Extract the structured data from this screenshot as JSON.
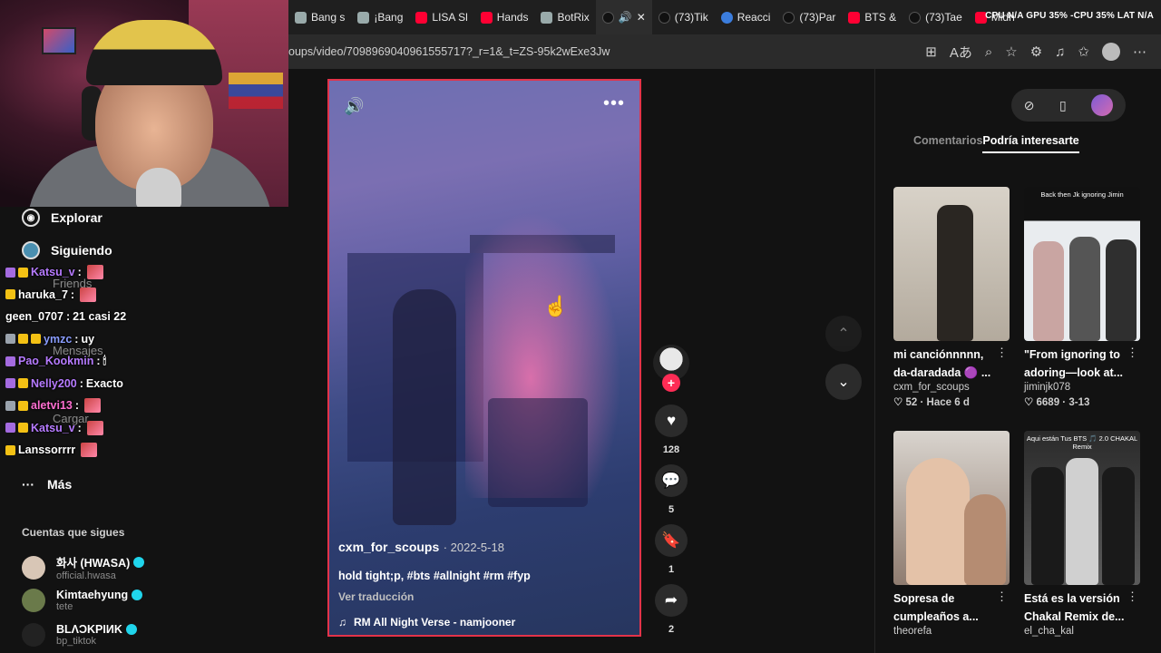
{
  "tabs": [
    {
      "label": "Bang s",
      "icon": "grid-icon",
      "active": false
    },
    {
      "label": "¡Bang",
      "icon": "grid-icon",
      "active": false
    },
    {
      "label": "LISA Sl",
      "icon": "youtube-icon",
      "active": false
    },
    {
      "label": "Hands",
      "icon": "youtube-icon",
      "active": false
    },
    {
      "label": "BotRix",
      "icon": "botrix-icon",
      "active": false
    },
    {
      "label": "",
      "icon": "tiktok-icon",
      "active": true
    },
    {
      "label": "(73)Tik",
      "icon": "tiktok-icon",
      "active": false
    },
    {
      "label": "Reacci",
      "icon": "c-icon",
      "active": false
    },
    {
      "label": "(73)Par",
      "icon": "tiktok-icon",
      "active": false
    },
    {
      "label": "BTS &",
      "icon": "youtube-icon",
      "active": false
    },
    {
      "label": "(73)Tae",
      "icon": "tiktok-icon",
      "active": false
    },
    {
      "label": "Midn",
      "icon": "youtube-icon",
      "active": false
    }
  ],
  "overlay_stats": "CPU N/A  GPU 35%  -CPU 35%  LAT N/A",
  "url": "oups/video/7098969040961555717?_r=1&_t=ZS-95k2wExe3Jw",
  "sidebar": {
    "nav": [
      {
        "label": "Explorar",
        "icon": "compass-icon"
      },
      {
        "label": "Siguiendo",
        "icon": "following-icon"
      }
    ],
    "faded": [
      "Friends",
      "Mensajes",
      "Cargar"
    ],
    "more_label": "Más",
    "following_title": "Cuentas que sigues",
    "accounts": [
      {
        "name": "화사 (HWASA)",
        "handle": "official.hwasa",
        "verified": true,
        "color": "#d8c6b6"
      },
      {
        "name": "Kimtaehyung",
        "handle": "tete",
        "verified": true,
        "color": "#6a7a4a"
      },
      {
        "name": "BLΛƆKPIИK",
        "handle": "bp_tiktok",
        "verified": true,
        "color": "#222"
      }
    ]
  },
  "chat": [
    {
      "user": "Katsu_v",
      "color": "#b67bff",
      "badges": [
        "b-p",
        "b-y"
      ],
      "text": "",
      "emote": true
    },
    {
      "user": "haruka_7",
      "color": "#ffffff",
      "badges": [
        "b-y"
      ],
      "text": "",
      "emote": true
    },
    {
      "user": "geen_0707",
      "color": "#ffffff",
      "badges": [],
      "text": "21 casi 22",
      "emote": false
    },
    {
      "user": "ymzc",
      "color": "#8a9dff",
      "badges": [
        "b-g",
        "b-y",
        "b-y"
      ],
      "text": "uy",
      "emote": false
    },
    {
      "user": "Pao_Kookmin",
      "color": "#b67bff",
      "badges": [
        "b-p"
      ],
      "text": "",
      "emote": false
    },
    {
      "user": "Nelly200",
      "color": "#b67bff",
      "badges": [
        "b-p",
        "b-y"
      ],
      "text": "Exacto",
      "emote": false
    },
    {
      "user": "aletvi13",
      "color": "#ff6fd1",
      "badges": [
        "b-g",
        "b-y"
      ],
      "text": "",
      "emote": true
    },
    {
      "user": "Katsu_v",
      "color": "#b67bff",
      "badges": [
        "b-p",
        "b-y"
      ],
      "text": "",
      "emote": true
    },
    {
      "user": "Lanssorrrr",
      "color": "#ffffff",
      "badges": [
        "b-y"
      ],
      "text": "",
      "emote": true
    }
  ],
  "video": {
    "username": "cxm_for_scoups",
    "date": "· 2022-5-18",
    "description": "hold tight;p, #bts #allnight #rm #fyp",
    "translate": "Ver traducción",
    "music": "RM All Night Verse - namjooner"
  },
  "actions": {
    "likes": "128",
    "comments": "5",
    "saves": "1",
    "shares": "2"
  },
  "right_panel": {
    "tab_comments": "Comentarios",
    "tab_interest": "Podría interesarte",
    "cards": [
      {
        "title": "mi canciónnnnn, da-daradada 🟣 ...",
        "author": "cxm_for_scoups",
        "likes": "52",
        "time": "Hace 6 d",
        "thumb_caption": "",
        "thumb": "t1"
      },
      {
        "title": "\"From ignoring to adoring—look at...",
        "author": "jiminjk078",
        "likes": "6689",
        "time": "3-13",
        "thumb_caption": "Back then Jk ignoring Jimin",
        "thumb": "t2"
      },
      {
        "title": "Sopresa de cumpleaños a...",
        "author": "theorefa",
        "likes": "",
        "time": "",
        "thumb_caption": "",
        "thumb": "t3"
      },
      {
        "title": "Está es la versión Chakal Remix de...",
        "author": "el_cha_kal",
        "likes": "",
        "time": "",
        "thumb_caption": "Aqui están Tus BTS 🎵 2.0 CHAKAL Remix",
        "thumb": "t4"
      }
    ]
  }
}
